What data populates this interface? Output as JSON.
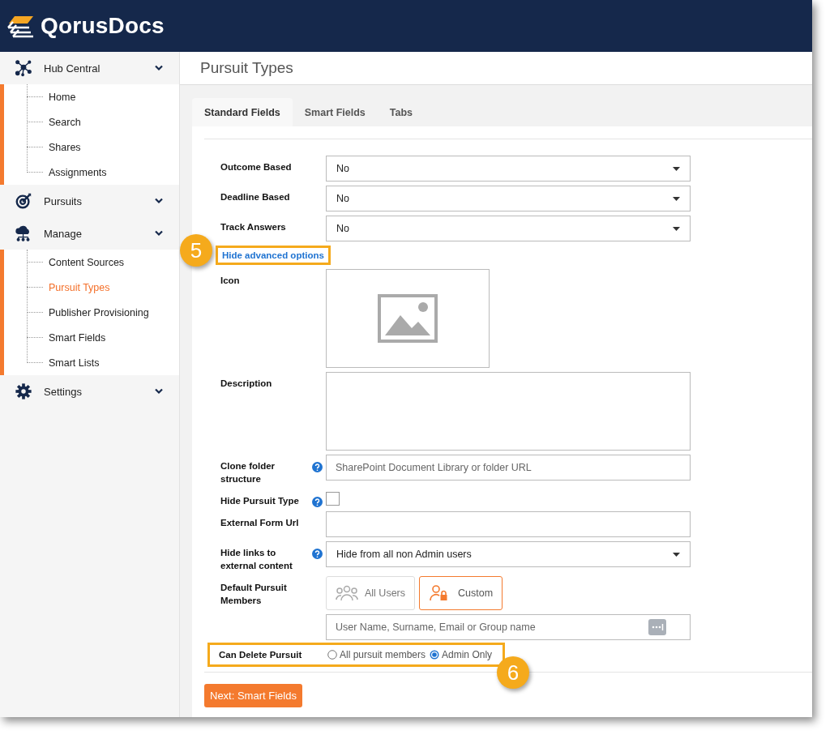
{
  "header": {
    "logo": "QorusDocs"
  },
  "sidebar": {
    "groups": [
      {
        "label": "Hub Central",
        "expanded": true,
        "items": [
          {
            "label": "Home",
            "selected": false
          },
          {
            "label": "Search",
            "selected": false
          },
          {
            "label": "Shares",
            "selected": false
          },
          {
            "label": "Assignments",
            "selected": false
          }
        ]
      },
      {
        "label": "Pursuits",
        "expanded": false
      },
      {
        "label": "Manage",
        "expanded": true,
        "items": [
          {
            "label": "Content Sources",
            "selected": false
          },
          {
            "label": "Pursuit Types",
            "selected": true
          },
          {
            "label": "Publisher Provisioning",
            "selected": false
          },
          {
            "label": "Smart Fields",
            "selected": false
          },
          {
            "label": "Smart Lists",
            "selected": false
          }
        ]
      },
      {
        "label": "Settings",
        "expanded": false
      }
    ]
  },
  "page": {
    "title": "Pursuit Types"
  },
  "tabs": [
    {
      "label": "Standard Fields",
      "selected": true
    },
    {
      "label": "Smart Fields",
      "selected": false
    },
    {
      "label": "Tabs",
      "selected": false
    }
  ],
  "form": {
    "fields": [
      {
        "kind": "select",
        "label": "Outcome Based",
        "value": "No"
      },
      {
        "kind": "select",
        "label": "Deadline Based",
        "value": "No"
      },
      {
        "kind": "select",
        "label": "Track Answers",
        "value": "No"
      },
      {
        "kind": "link",
        "text": "Hide advanced options",
        "highlighted": true,
        "callout": "5"
      },
      {
        "kind": "image",
        "label": "Icon"
      },
      {
        "kind": "textarea",
        "label": "Description"
      },
      {
        "kind": "text",
        "label": "Clone folder structure",
        "help": true,
        "placeholder": "SharePoint Document Library or folder URL"
      },
      {
        "kind": "checkbox",
        "label": "Hide Pursuit Type",
        "help": true,
        "checked": false
      },
      {
        "kind": "text",
        "label": "External Form Url",
        "help": false
      },
      {
        "kind": "select",
        "label": "Hide links to external content",
        "help": true,
        "value": "Hide from all non Admin users"
      },
      {
        "kind": "members",
        "label": "Default Pursuit Members",
        "options": [
          {
            "label": "All Users",
            "selected": false
          },
          {
            "label": "Custom",
            "selected": true
          }
        ],
        "placeholder": "User Name, Surname, Email or Group name"
      },
      {
        "kind": "radio",
        "label": "Can Delete Pursuit",
        "highlighted": true,
        "callout": "6",
        "options": [
          {
            "label": "All pursuit members",
            "selected": false
          },
          {
            "label": "Admin Only",
            "selected": true
          }
        ]
      }
    ]
  },
  "next_button": "Next: Smart Fields"
}
